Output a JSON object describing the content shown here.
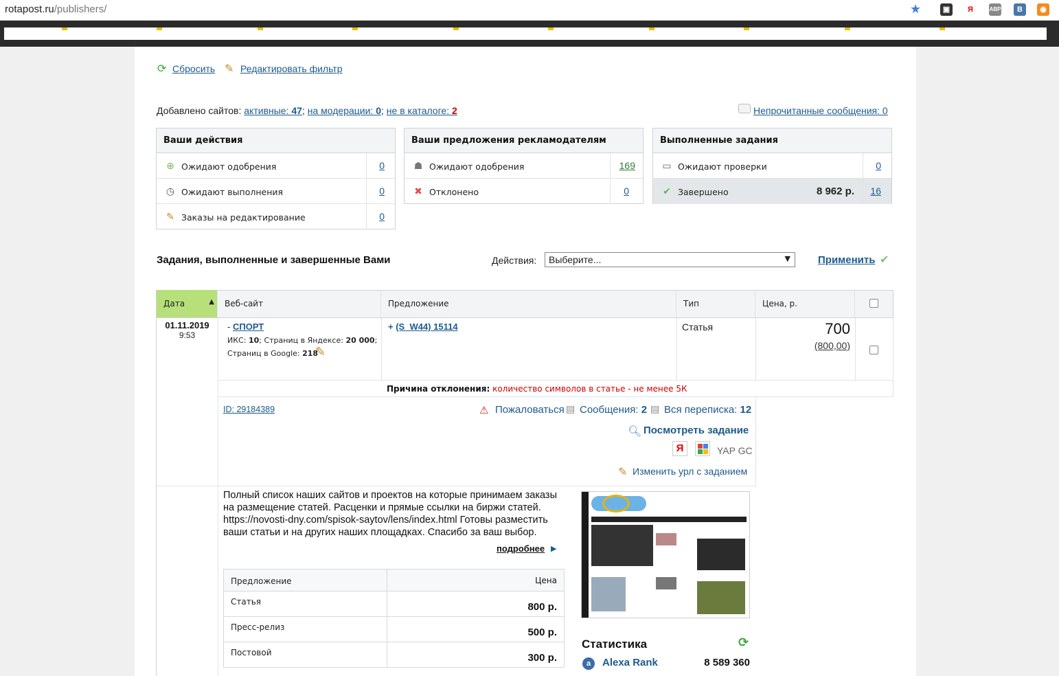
{
  "browser": {
    "url_host": "rotapost.ru",
    "url_path": "/publishers/"
  },
  "toolbar": {
    "reset": "Сбросить",
    "edit_filter": "Редактировать фильтр"
  },
  "sites": {
    "prefix": "Добавлено сайтов:",
    "active_label": "активные:",
    "active_count": "47",
    "moderation_label": "на модерации:",
    "moderation_count": "0",
    "not_in_catalog_label": "не в каталоге:",
    "not_in_catalog_count": "2",
    "unread_messages": "Непрочитанные сообщения: 0"
  },
  "panels": {
    "actions": {
      "title": "Ваши действия",
      "rows": [
        {
          "label": "Ожидают одобрения",
          "count": "0"
        },
        {
          "label": "Ожидают выполнения",
          "count": "0"
        },
        {
          "label": "Заказы на редактирование",
          "count": "0"
        }
      ]
    },
    "offers": {
      "title": "Ваши предложения рекламодателям",
      "rows": [
        {
          "label": "Ожидают одобрения",
          "count": "169"
        },
        {
          "label": "Отклонено",
          "count": "0"
        }
      ]
    },
    "completed": {
      "title": "Выполненные задания",
      "rows": [
        {
          "label": "Ожидают проверки",
          "count": "0"
        },
        {
          "label": "Завершено",
          "amount": "8 962 р.",
          "count": "16"
        }
      ]
    }
  },
  "tasks": {
    "heading": "Задания, выполненные и завершенные Вами",
    "actions_label": "Действия:",
    "select_value": "Выберите...",
    "apply": "Применить",
    "columns": {
      "date": "Дата",
      "site": "Веб-сайт",
      "offer": "Предложение",
      "type": "Тип",
      "price": "Цена, р."
    },
    "row": {
      "date": "01.11.2019",
      "time": "9:53",
      "site_prefix": "-",
      "site_name": "СПОРТ",
      "iks_label": "ИКС:",
      "iks_value": "10",
      "yandex_label": "; Страниц в Яндексе:",
      "yandex_value": "20 000",
      "google_label": "Страниц в Google:",
      "google_value": "218",
      "offer_prefix": "+",
      "offer_name": "(S_W44) 15114",
      "type": "Статья",
      "price": "700",
      "price_orig": "(800,00)",
      "reject_label": "Причина отклонения:",
      "reject_reason": "количество символов в статье - не менее 5К",
      "id": "ID: 29184389",
      "complain": "Пожаловаться",
      "messages_label": "Сообщения:",
      "messages_count": "2",
      "correspondence_label": "Вся переписка:",
      "correspondence_count": "12",
      "view_task": "Посмотреть задание",
      "yap_gc": "YAP GC",
      "change_url": "Изменить урл с заданием"
    }
  },
  "site_info": {
    "description": "Полный список наших сайтов и проектов на которые принимаем заказы на размещение статей. Расценки и прямые ссылки на биржи статей. https://novosti-dny.com/spisok-saytov/lens/index.html Готовы разместить ваши статьи и на других наших площадках. Спасибо за ваш выбор.",
    "more": "подробнее",
    "price_table": {
      "header": {
        "offer": "Предложение",
        "price": "Цена"
      },
      "rows": [
        {
          "offer": "Статья",
          "price": "800 р."
        },
        {
          "offer": "Пресс-релиз",
          "price": "500 р."
        },
        {
          "offer": "Постовой",
          "price": "300 р."
        }
      ]
    },
    "stats_title": "Статистика",
    "alexa_label": "Alexa Rank",
    "alexa_value": "8 589 360"
  },
  "colors": {
    "link": "#1d5a8e",
    "sort_header": "#b8e07a",
    "reject_red": "#cc0000",
    "count_red": "#cc0000"
  }
}
